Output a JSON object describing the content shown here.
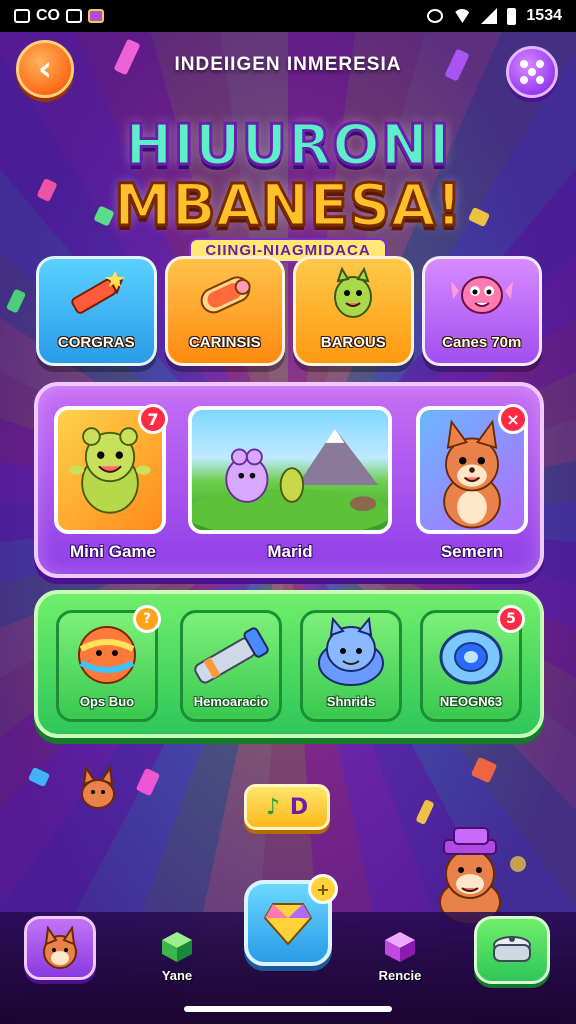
{
  "status_bar": {
    "left_text": "CO",
    "time": "1534"
  },
  "header": {
    "title": "INDEIIGEN INMERESIA",
    "back_icon": "chevron-left-icon",
    "menu_icon": "grid-dots-icon"
  },
  "logo": {
    "line1": "HIUURONI",
    "line2": "MBANESA!",
    "subtitle": "CIINGI-NIAGMIDACA"
  },
  "categories": [
    {
      "label": "CORGRAS",
      "icon": "crayon-icon",
      "color": "#37b8f5"
    },
    {
      "label": "CARINSIS",
      "icon": "burrito-icon",
      "color": "#ff9d1e"
    },
    {
      "label": "BAROUS",
      "icon": "monster-icon",
      "color": "#ffa21a"
    },
    {
      "label": "Canes 70m",
      "icon": "fish-creature-icon",
      "color": "#c274f5"
    }
  ],
  "featured": [
    {
      "label": "Mini Game",
      "badge": "7"
    },
    {
      "label": "Marid"
    },
    {
      "label": "Semern",
      "badge": "×"
    }
  ],
  "items": [
    {
      "label": "Ops Buo",
      "badge": "?"
    },
    {
      "label": "Hemoaracio"
    },
    {
      "label": "Shnrids"
    },
    {
      "label": "NEOGN63",
      "badge": "5"
    }
  ],
  "music_button": {
    "icon": "music-note-icon",
    "glyph_left": "♪",
    "glyph_right": "D"
  },
  "bottom_nav": [
    {
      "label": "",
      "icon": "fox-avatar-icon"
    },
    {
      "label": "Yane",
      "icon": "cube-icon"
    },
    {
      "label": "",
      "icon": "gem-icon",
      "badge": "+"
    },
    {
      "label": "Rencie",
      "icon": "purple-cube-icon"
    },
    {
      "label": "",
      "icon": "pot-icon"
    }
  ],
  "colors": {
    "accent_orange": "#ff6a1a",
    "accent_purple": "#9a3cf0",
    "panel_green": "#2fc65a",
    "badge_red": "#ff2a44"
  }
}
